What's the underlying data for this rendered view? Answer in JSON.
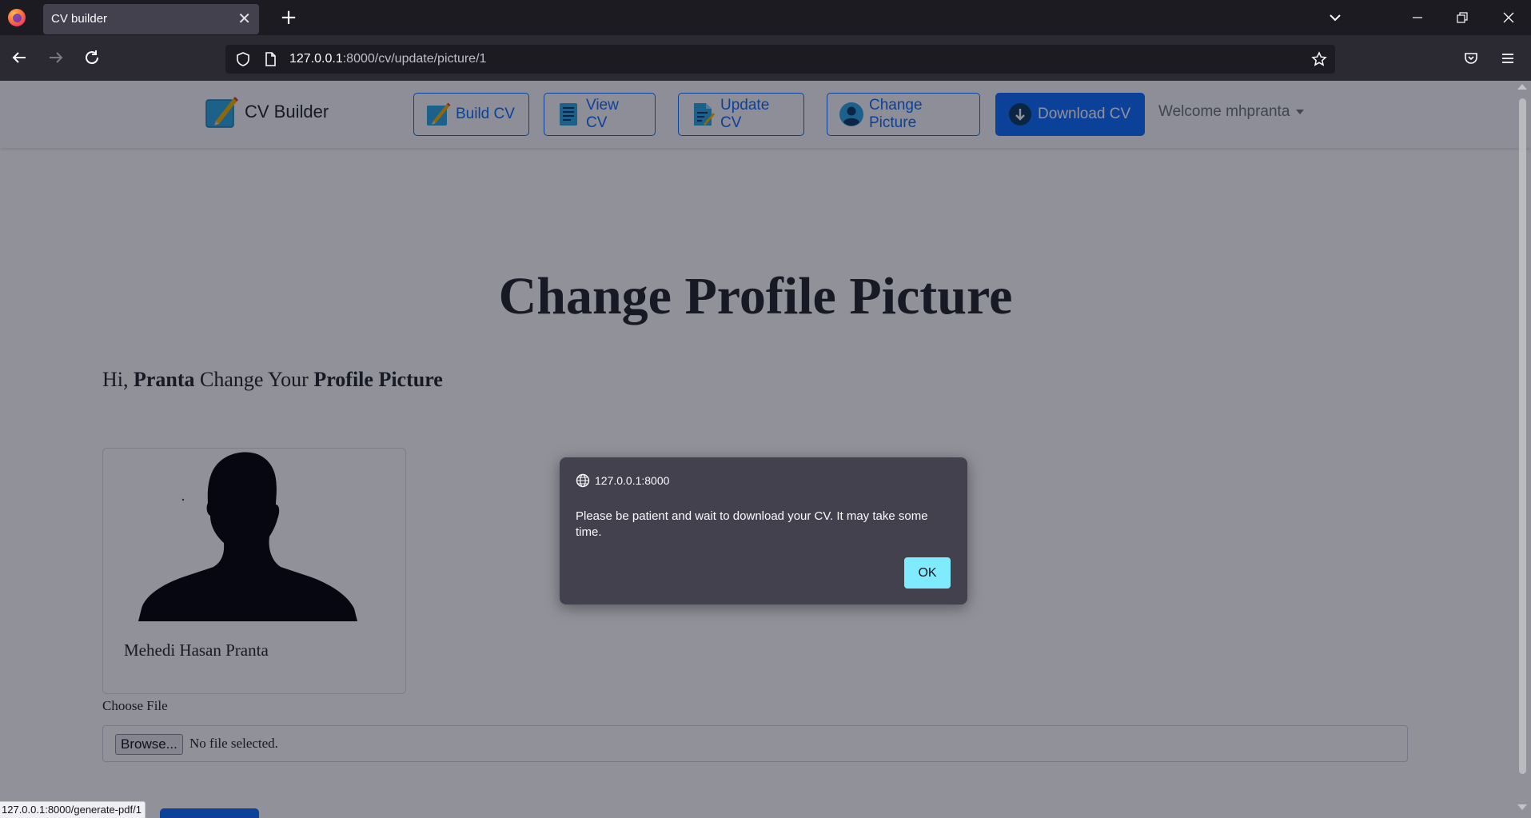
{
  "browser": {
    "tab_title": "CV builder",
    "tab_close": "✕",
    "new_tab": "+",
    "url_host": "127.0.0.1",
    "url_rest": ":8000/cv/update/picture/1",
    "status_url": "127.0.0.1:8000/generate-pdf/1"
  },
  "site": {
    "brand": "CV Builder",
    "nav": {
      "build": "Build CV",
      "view": "View CV",
      "update": "Update CV",
      "change_picture": "Change Picture",
      "download": "Download CV"
    },
    "welcome": "Welcome mhpranta"
  },
  "page": {
    "title": "Change Profile Picture",
    "greeting_prefix": "Hi, ",
    "greeting_name": "Pranta",
    "greeting_middle": " Change Your ",
    "greeting_bold": "Profile Picture"
  },
  "profile_card": {
    "name": "Mehedi Hasan Pranta"
  },
  "file_input": {
    "label": "Choose File",
    "button": "Browse...",
    "status": "No file selected."
  },
  "dialog": {
    "origin": "127.0.0.1:8000",
    "message": "Please be patient and wait to download your CV. It may take some time.",
    "ok": "OK"
  },
  "colors": {
    "primary": "#0d6efd",
    "dialog_bg": "#42414d",
    "ok_button": "#80ebff",
    "chrome_dark": "#1c1b22"
  }
}
